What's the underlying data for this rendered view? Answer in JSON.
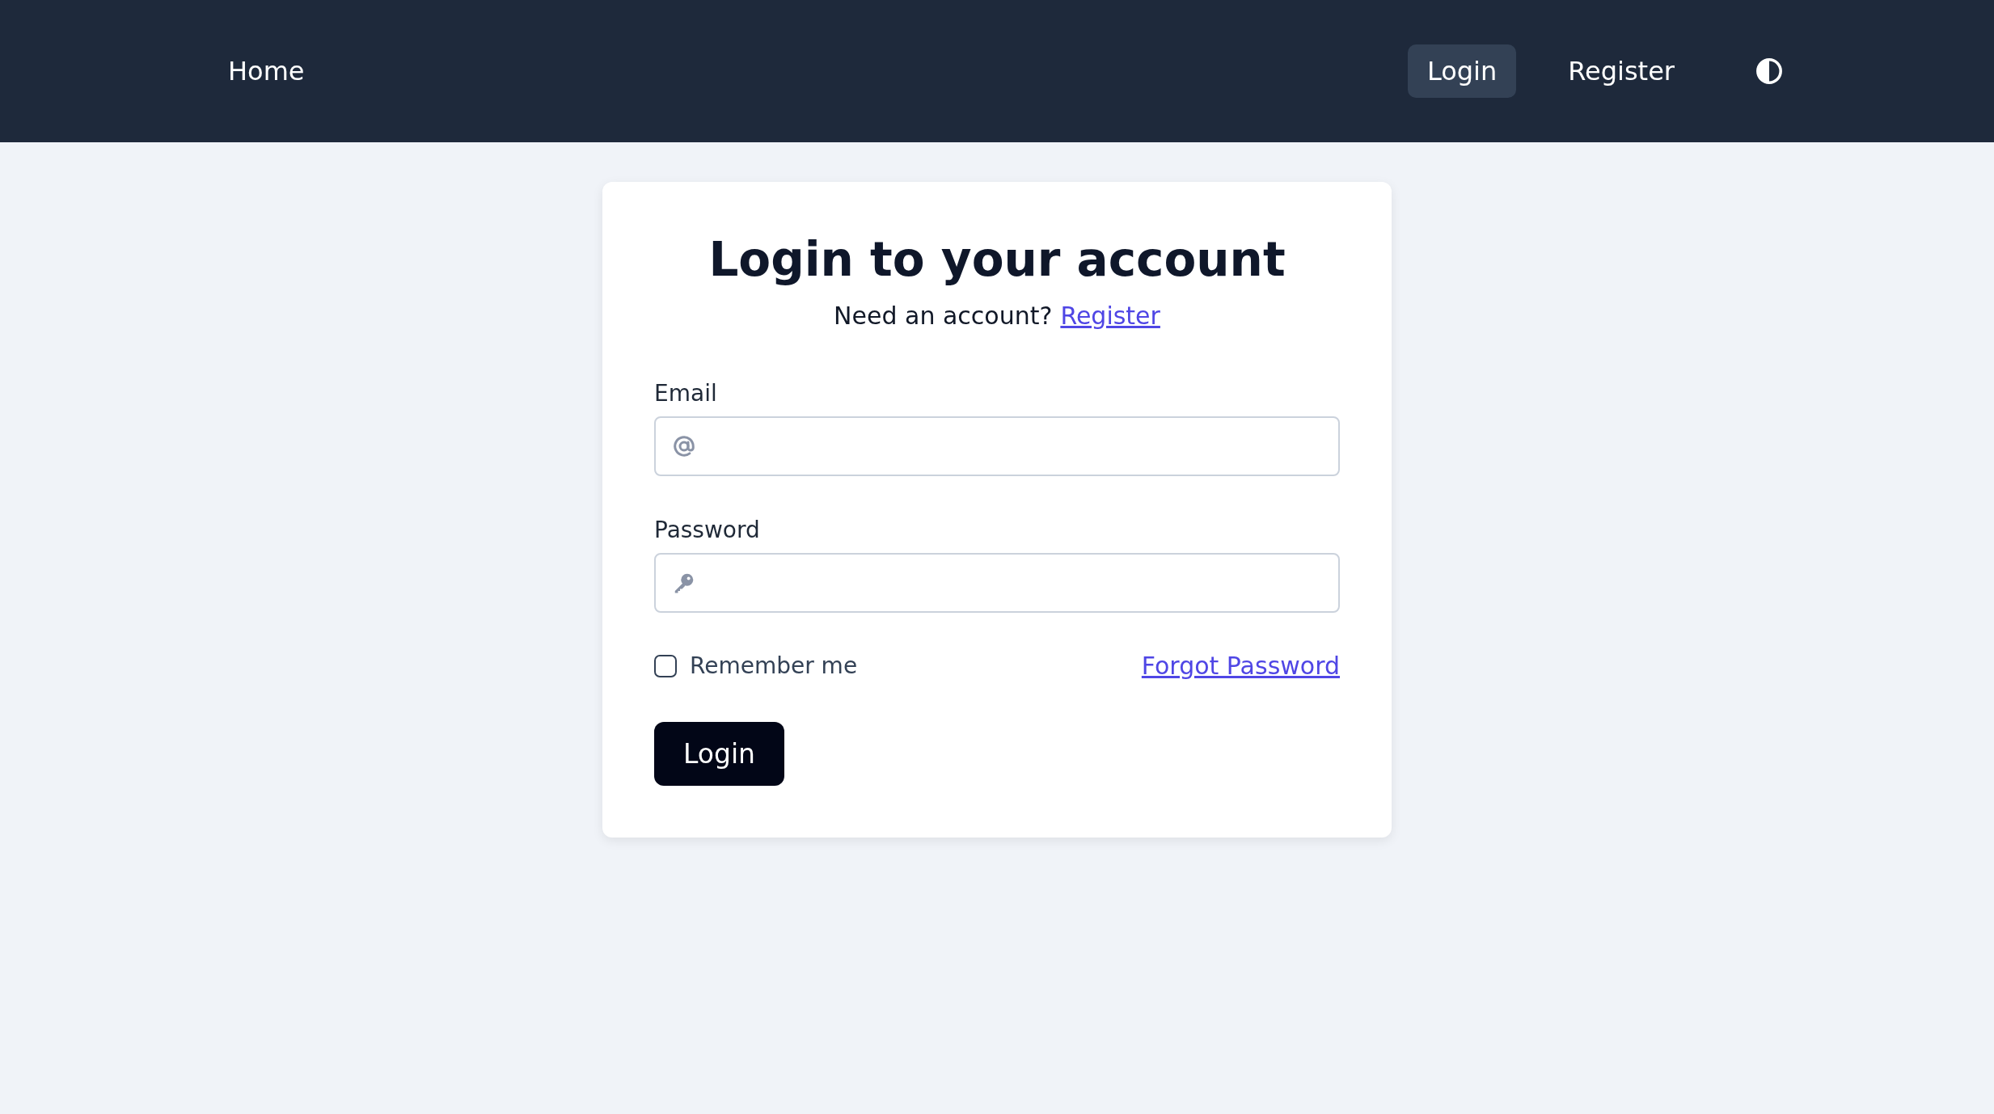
{
  "nav": {
    "home": "Home",
    "items": [
      {
        "label": "Login",
        "selected": true
      },
      {
        "label": "Register",
        "selected": false
      }
    ]
  },
  "card": {
    "title": "Login to your account",
    "subtitle": {
      "text": "Need an account?",
      "link": "Register"
    },
    "fields": [
      {
        "label": "Email",
        "kind": "email"
      },
      {
        "label": "Password",
        "kind": "password"
      }
    ],
    "remember": {
      "label": "Remember me",
      "checked": false
    },
    "forgot": "Forgot Password",
    "submit": "Login"
  }
}
